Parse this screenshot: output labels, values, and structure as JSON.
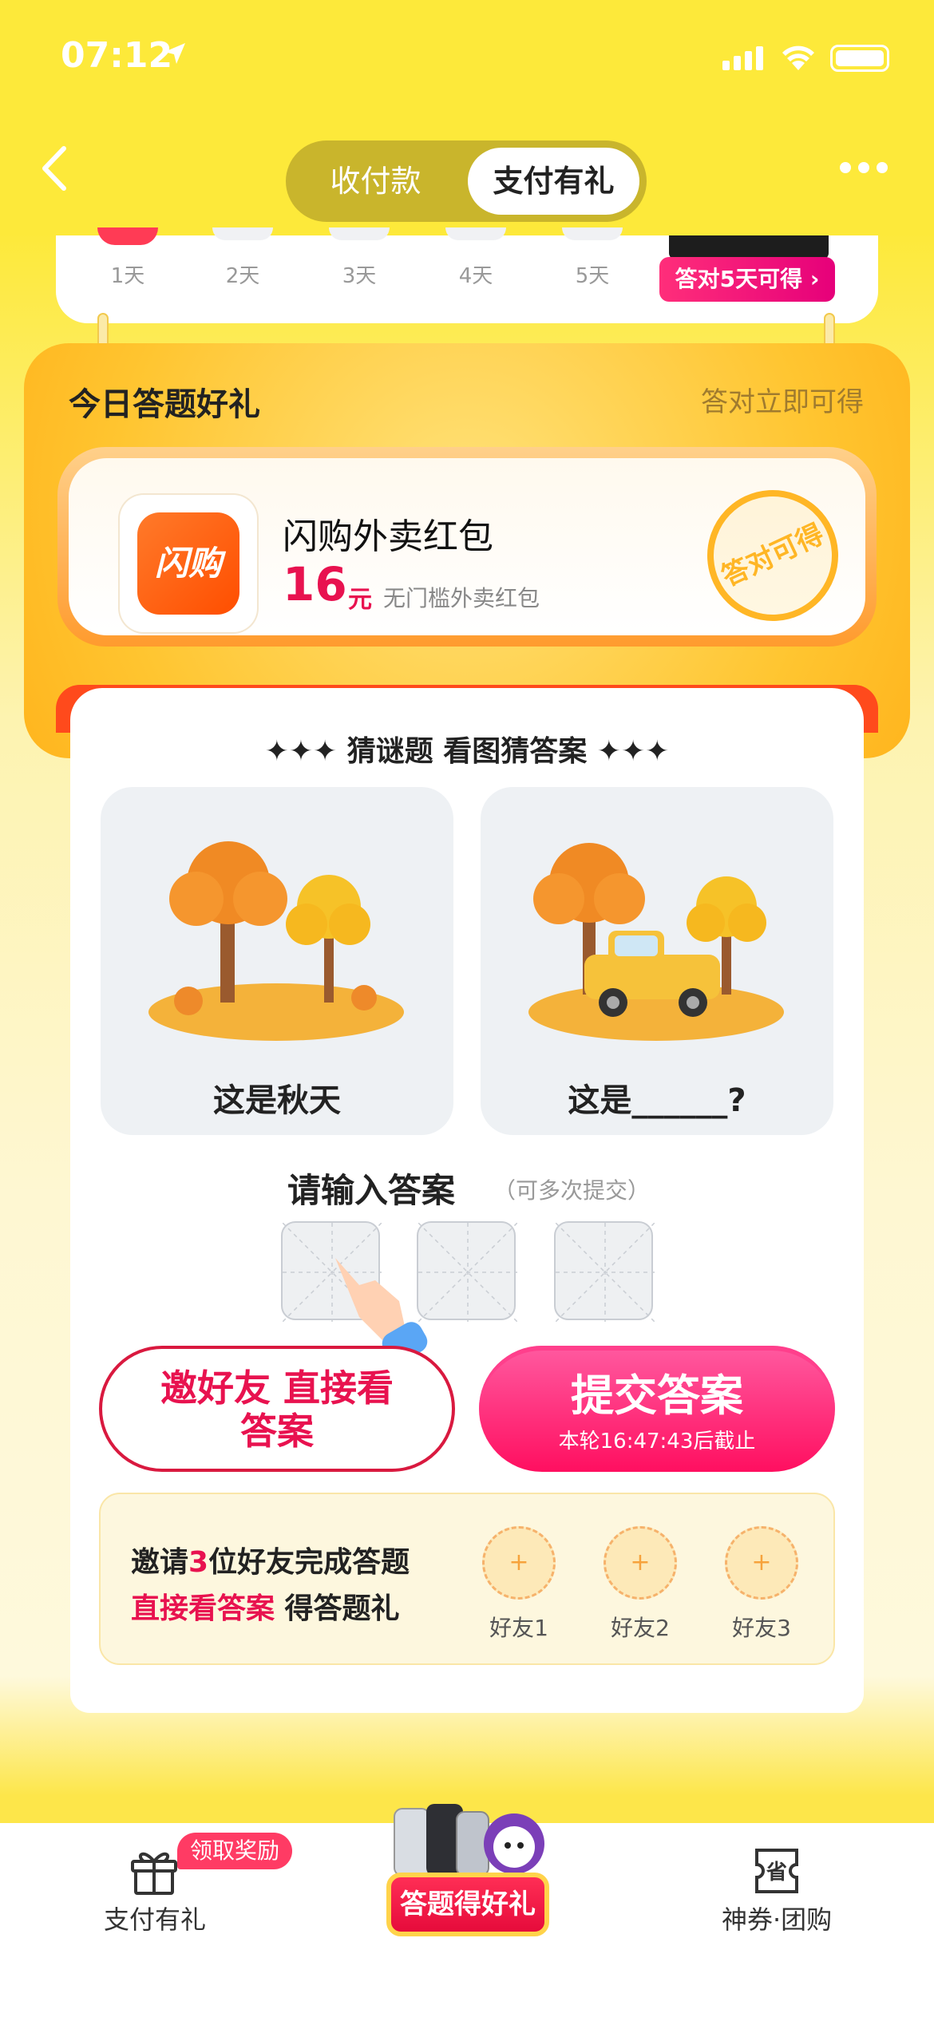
{
  "status_bar": {
    "time": "07:12"
  },
  "header": {
    "tabs": [
      "收付款",
      "支付有礼"
    ],
    "active_tab": 1
  },
  "days": [
    "1天",
    "2天",
    "3天",
    "4天",
    "5天"
  ],
  "streak_reward": {
    "label": "答对5天可得 ›"
  },
  "gift": {
    "title": "今日答题好礼",
    "subtitle": "答对立即可得",
    "app_icon_text": "闪购",
    "coupon_title": "闪购外卖红包",
    "amount": "16",
    "unit": "元",
    "description": "无门槛外卖红包",
    "stamp": "答对可得"
  },
  "quiz": {
    "title": "✦✦✦ 猜谜题 看图猜答案 ✦✦✦",
    "left_caption": "这是秋天",
    "right_caption": "这是______?",
    "answer_label": "请输入答案",
    "answer_hint": "（可多次提交）",
    "answer_slots": 3
  },
  "buttons": {
    "invite_line1": "邀好友 直接看",
    "invite_line2": "答案",
    "submit": "提交答案",
    "deadline": "本轮16:47:43后截止"
  },
  "invite": {
    "line1_a": "邀请",
    "line1_num": "3",
    "line1_b": "位好友完成答题",
    "line2_a": "直接看答案",
    "line2_b": " 得答题礼",
    "friends": [
      "好友1",
      "好友2",
      "好友3"
    ],
    "plus": "+"
  },
  "tabbar": {
    "left": "支付有礼",
    "badge": "领取奖励",
    "center": "答题得好礼",
    "right": "神券·团购",
    "right_icon_text": "省"
  },
  "colors": {
    "accent": "#e8124f",
    "brand_yellow": "#fde93a"
  }
}
